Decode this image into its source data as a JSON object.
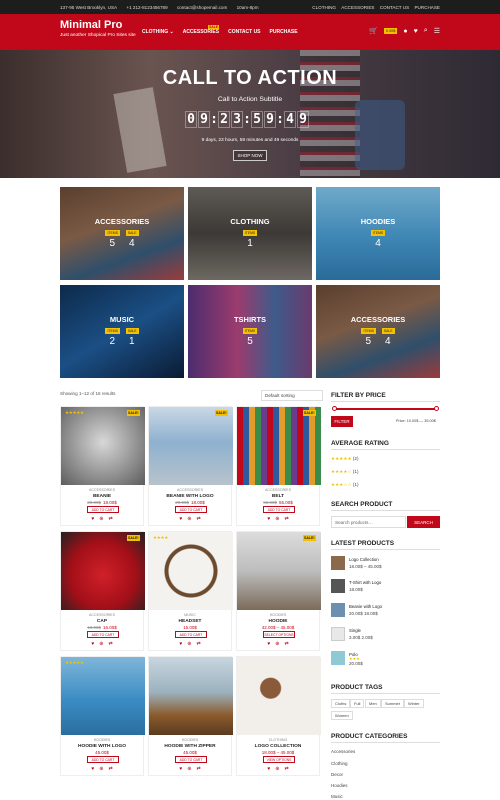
{
  "topbar": {
    "address": "137-95 West Brooklyn, USA",
    "phone": "+1 212-8123456789",
    "email": "contact@shopemail.com",
    "hours": "10am-8pm",
    "links": [
      "CLOTHING",
      "ACCESSORIES",
      "CONTACT US",
      "PURCHASE"
    ]
  },
  "header": {
    "logo": "Minimal Pro",
    "tagline": "Just another Shopical Pro Sites site",
    "nav": [
      "CLOTHING",
      "ACCESSORIES",
      "CONTACT US",
      "PURCHASE"
    ],
    "sale_tag": "SALE",
    "cart_total": "0.00$",
    "colors": {
      "brand": "#c1081b",
      "accent": "#f5c000"
    }
  },
  "hero": {
    "title": "CALL TO ACTION",
    "subtitle": "Call to Action Subtitle",
    "countdown": [
      "0",
      "9",
      "2",
      "3",
      "5",
      "9",
      "4",
      "9"
    ],
    "remaining": "9 days, 23 hours, 59 minutes and 49 seconds",
    "button": "SHOP NOW"
  },
  "categories": [
    {
      "name": "ACCESSORIES",
      "badges": [
        "ITEMS",
        "SALE"
      ],
      "nums": [
        "5",
        "4"
      ]
    },
    {
      "name": "CLOTHING",
      "badges": [
        "ITEMS"
      ],
      "nums": [
        "1"
      ]
    },
    {
      "name": "HOODIES",
      "badges": [
        "ITEMS"
      ],
      "nums": [
        "4"
      ]
    },
    {
      "name": "MUSIC",
      "badges": [
        "ITEMS",
        "SALE"
      ],
      "nums": [
        "2",
        "1"
      ]
    },
    {
      "name": "TSHIRTS",
      "badges": [
        "ITEMS"
      ],
      "nums": [
        "5"
      ]
    },
    {
      "name": "ACCESSORIES",
      "badges": [
        "ITEMS",
        "SALE"
      ],
      "nums": [
        "5",
        "4"
      ]
    }
  ],
  "shop": {
    "results": "Showing 1–12 of 16 results",
    "sort": "Default sorting"
  },
  "products": [
    {
      "cat": "ACCESSORIES",
      "name": "BEANIE",
      "old": "20.00$",
      "price": "18.00$",
      "btn": "ADD TO CART",
      "sale": "SALE!",
      "stars": "★★★★★"
    },
    {
      "cat": "ACCESSORIES",
      "name": "BEANIE WITH LOGO",
      "old": "20.00$",
      "price": "18.00$",
      "btn": "ADD TO CART",
      "sale": "SALE!",
      "stars": ""
    },
    {
      "cat": "ACCESSORIES",
      "name": "BELT",
      "old": "65.00$",
      "price": "55.00$",
      "btn": "ADD TO CART",
      "sale": "SALE!",
      "stars": ""
    },
    {
      "cat": "ACCESSORIES",
      "name": "CAP",
      "old": "18.00$",
      "price": "16.00$",
      "btn": "ADD TO CART",
      "sale": "SALE!",
      "stars": ""
    },
    {
      "cat": "MUSIC",
      "name": "HEADSET",
      "old": "",
      "price": "15.00$",
      "btn": "ADD TO CART",
      "sale": "",
      "stars": "★★★★"
    },
    {
      "cat": "HOODIES",
      "name": "HOODIE",
      "old": "",
      "price": "42.00$ – 45.00$",
      "btn": "SELECT OPTIONS",
      "sale": "SALE!",
      "stars": ""
    },
    {
      "cat": "HOODIES",
      "name": "HOODIE WITH LOGO",
      "old": "",
      "price": "45.00$",
      "btn": "ADD TO CART",
      "sale": "",
      "stars": "★★★★★"
    },
    {
      "cat": "HOODIES",
      "name": "HOODIE WITH ZIPPER",
      "old": "",
      "price": "45.00$",
      "btn": "ADD TO CART",
      "sale": "",
      "stars": ""
    },
    {
      "cat": "CLOTHING",
      "name": "LOGO COLLECTION",
      "old": "",
      "price": "18.00$ – 45.00$",
      "btn": "VIEW OPTIONS",
      "sale": "",
      "stars": ""
    }
  ],
  "sidebar": {
    "filter_title": "FILTER BY PRICE",
    "filter_btn": "FILTER",
    "price_range": "Price: 10.00$ — 35.00$",
    "rating_title": "AVERAGE RATING",
    "ratings": [
      {
        "stars": "★★★★★",
        "count": "(2)"
      },
      {
        "stars": "★★★★☆",
        "count": "(1)"
      },
      {
        "stars": "★★★☆☆",
        "count": "(1)"
      }
    ],
    "search_title": "SEARCH PRODUCT",
    "search_placeholder": "Search products…",
    "search_btn": "SEARCH",
    "latest_title": "LATEST PRODUCTS",
    "latest": [
      {
        "name": "Logo Collection",
        "price": "18.00$ – 45.00$",
        "stars": ""
      },
      {
        "name": "T-Shirt with Logo",
        "price": "18.00$",
        "stars": ""
      },
      {
        "name": "Beanie with Logo",
        "price": "20.00$ 18.00$",
        "stars": ""
      },
      {
        "name": "Single",
        "price": "3.00$ 2.00$",
        "stars": ""
      },
      {
        "name": "Polo",
        "price": "20.00$",
        "stars": "★★★"
      }
    ],
    "tags_title": "PRODUCT TAGS",
    "tags": [
      "Cloths",
      "Full",
      "Men",
      "Summer",
      "Winter",
      "Women"
    ],
    "pcat_title": "PRODUCT CATEGORIES",
    "pcats": [
      "Accessories",
      "Clothing",
      "Decor",
      "Hoodies",
      "Music"
    ]
  }
}
